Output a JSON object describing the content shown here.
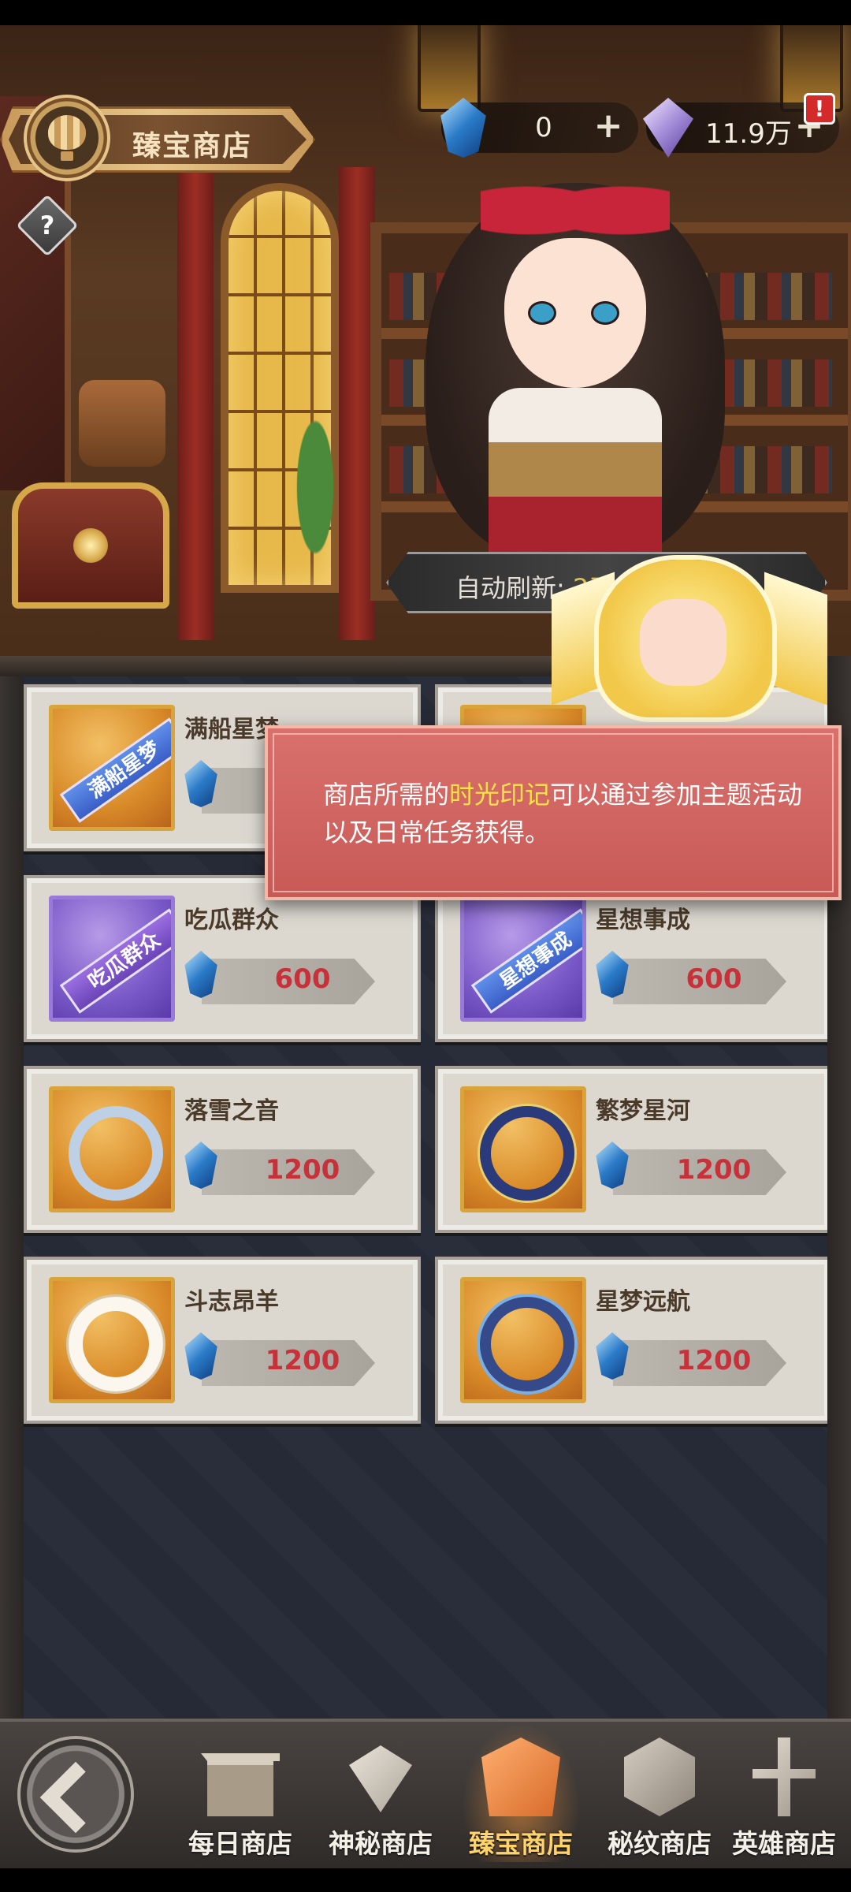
{
  "header": {
    "shop_title": "臻宝商店",
    "help_label": "?",
    "currencies": [
      {
        "icon": "time-mark-crystal-icon",
        "value": "0",
        "plus": "+"
      },
      {
        "icon": "diamond-icon",
        "value": "11.9万",
        "plus": "+"
      }
    ],
    "alert_badge": "!"
  },
  "refresh": {
    "label": "自动刷新:",
    "time_visible": "2天",
    "time_tail": "4"
  },
  "items": [
    {
      "name": "满船星梦",
      "price": "",
      "thumb_text": "满船星梦"
    },
    {
      "name": "",
      "price": ""
    },
    {
      "name": "吃瓜群众",
      "price": "600",
      "thumb_text": "吃瓜群众"
    },
    {
      "name": "星想事成",
      "price": "600",
      "thumb_text": "星想事成"
    },
    {
      "name": "落雪之音",
      "price": "1200"
    },
    {
      "name": "繁梦星河",
      "price": "1200"
    },
    {
      "name": "斗志昂羊",
      "price": "1200"
    },
    {
      "name": "星梦远航",
      "price": "1200"
    }
  ],
  "tooltip": {
    "pre": "商店所需的",
    "highlight": "时光印记",
    "post": "可以通过参加主题活动以及日常任务获得。"
  },
  "nav": {
    "tabs": [
      {
        "label": "每日商店",
        "icon": "gift-box-icon"
      },
      {
        "label": "神秘商店",
        "icon": "diamond-stand-icon"
      },
      {
        "label": "臻宝商店",
        "icon": "crest-icon",
        "active": true
      },
      {
        "label": "秘纹商店",
        "icon": "hex-emblem-icon"
      },
      {
        "label": "英雄商店",
        "icon": "sword-icon"
      }
    ]
  },
  "colors": {
    "price_red": "#c8303a",
    "tooltip_bg": "#d9706c",
    "highlight_yellow": "#ffe24a",
    "active_tab": "#ffd36a"
  }
}
